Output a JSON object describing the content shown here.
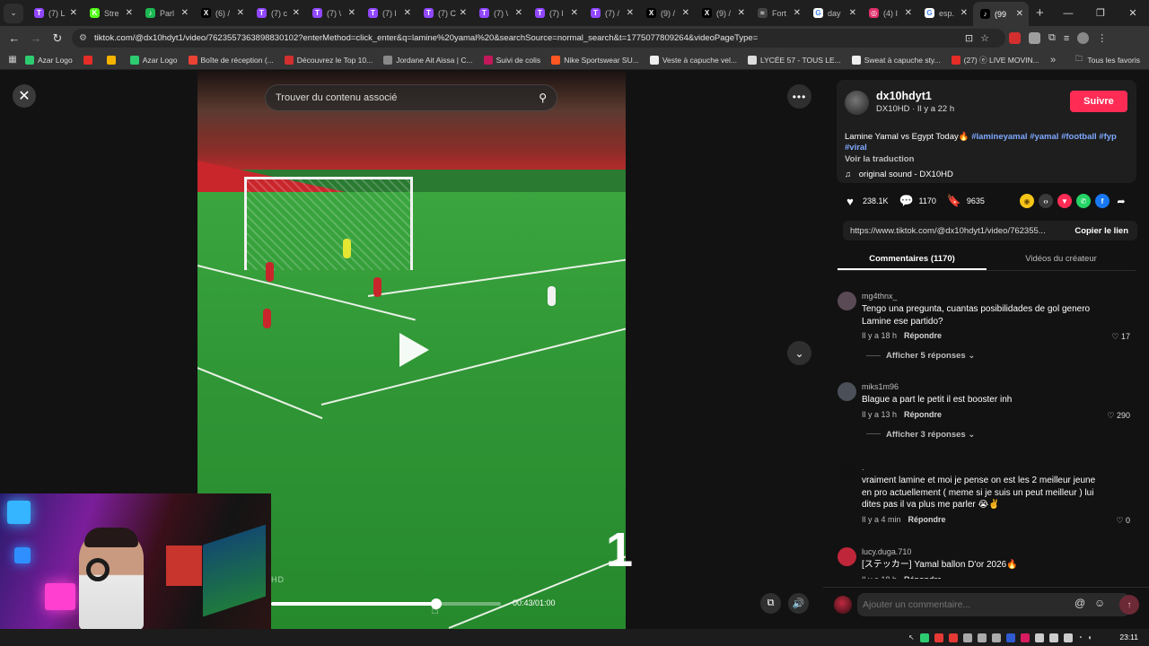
{
  "browser": {
    "tabs": [
      {
        "label": "(7) L",
        "color": "#9147ff",
        "glyph": "T"
      },
      {
        "label": "Stre",
        "color": "#53fc18",
        "glyph": "K"
      },
      {
        "label": "Parl",
        "color": "#1db954",
        "glyph": "♪"
      },
      {
        "label": "(6) /",
        "color": "#000000",
        "glyph": "X"
      },
      {
        "label": "(7) c",
        "color": "#9147ff",
        "glyph": "T"
      },
      {
        "label": "(7) \\",
        "color": "#9147ff",
        "glyph": "T"
      },
      {
        "label": "(7) l",
        "color": "#9147ff",
        "glyph": "T"
      },
      {
        "label": "(7) C",
        "color": "#9147ff",
        "glyph": "T"
      },
      {
        "label": "(7) \\",
        "color": "#9147ff",
        "glyph": "T"
      },
      {
        "label": "(7) l",
        "color": "#9147ff",
        "glyph": "T"
      },
      {
        "label": "(7) /",
        "color": "#9147ff",
        "glyph": "T"
      },
      {
        "label": "(9) /",
        "color": "#000000",
        "glyph": "X"
      },
      {
        "label": "(9) /",
        "color": "#000000",
        "glyph": "X"
      },
      {
        "label": "Fort",
        "color": "#444444",
        "glyph": "≈"
      },
      {
        "label": "day",
        "color": "#ffffff",
        "glyph": "G"
      },
      {
        "label": "(4) I",
        "color": "#e1306c",
        "glyph": "◎"
      },
      {
        "label": "esp.",
        "color": "#ffffff",
        "glyph": "G"
      },
      {
        "label": "(99",
        "color": "#000000",
        "glyph": "♪"
      }
    ],
    "url": "tiktok.com/@dx10hdyt1/video/7623557363898830102?enterMethod=click_enter&q=lamine%20yamal%20&searchSource=normal_search&t=1775077809264&videoPageType=",
    "bookmarks": [
      {
        "label": "Azar Logo",
        "color": "#2ecc71"
      },
      {
        "label": "",
        "color": "#e52d27"
      },
      {
        "label": "",
        "color": "#f4b400"
      },
      {
        "label": "Azar Logo",
        "color": "#2ecc71"
      },
      {
        "label": "Boîte de réception (...",
        "color": "#ea4335"
      },
      {
        "label": "Découvrez le Top 10...",
        "color": "#d32f2f"
      },
      {
        "label": "Jordane Ait Aissa | C...",
        "color": "#888888"
      },
      {
        "label": "Suivi de colis",
        "color": "#c2185b"
      },
      {
        "label": "Nike Sportswear SU...",
        "color": "#ff5722"
      },
      {
        "label": "Veste à capuche vel...",
        "color": "#eeeeee"
      },
      {
        "label": "LYCÉE 57 - TOUS LE...",
        "color": "#dddddd"
      },
      {
        "label": "Sweat à capuche sty...",
        "color": "#eeeeee"
      },
      {
        "label": "(27) ⓔ LIVE MOVIN...",
        "color": "#e52d27"
      }
    ],
    "bookmarks_all": "Tous les favoris"
  },
  "video": {
    "search_placeholder": "Trouver du contenu associé",
    "watermark": "HD",
    "overlay_number": "1",
    "time": "00:43/01:00",
    "progress": 0.72
  },
  "author": {
    "username": "dx10hdyt1",
    "display": "DX10HD · Il y a 22 h",
    "follow": "Suivre"
  },
  "post": {
    "text": "Lamine Yamal vs Egypt Today🔥",
    "tags": [
      "#lamineyamal",
      "#yamal",
      "#football",
      "#fyp",
      "#viral"
    ],
    "translate": "Voir la traduction",
    "sound": "original sound - DX10HD"
  },
  "stats": {
    "likes": "238.1K",
    "comments": "1170",
    "saves": "9635"
  },
  "link": {
    "url": "https://www.tiktok.com/@dx10hdyt1/video/762355...",
    "copy": "Copier le lien"
  },
  "panel_tabs": {
    "comments": "Commentaires (1170)",
    "creator": "Vidéos du créateur"
  },
  "comments": [
    {
      "user": "mg4thnx_",
      "text": "Tengo una pregunta, cuantas posibilidades de gol genero Lamine ese partido?",
      "time": "Il y a 18 h",
      "reply": "Répondre",
      "likes": "17",
      "replies": "Afficher 5 réponses",
      "avatar": "#5a4a55"
    },
    {
      "user": "miks1m96",
      "text": "Blague a part le petit il est booster inh",
      "time": "Il y a 13 h",
      "reply": "Répondre",
      "likes": "290",
      "replies": "Afficher 3 réponses",
      "avatar": "#4a4f58"
    },
    {
      "user": ".",
      "text": "vraiment lamine et moi je pense on est les 2 meilleur jeune en pro actuellement ( meme si je suis un peut meilleur ) lui dites pas il va plus me parler 😭✌️",
      "time": "Il y a 4 min",
      "reply": "Répondre",
      "likes": "0",
      "replies": "",
      "avatar": "#111111"
    },
    {
      "user": "lucy.duga.710",
      "text": "[ステッカー] Yamal ballon D'or 2026🔥",
      "time": "Il y a 18 h",
      "reply": "Répondre",
      "likes": "",
      "replies": "",
      "avatar": "#c0263a"
    }
  ],
  "comment_input": "Ajouter un commentaire...",
  "taskbar": {
    "clock": "23:11"
  }
}
